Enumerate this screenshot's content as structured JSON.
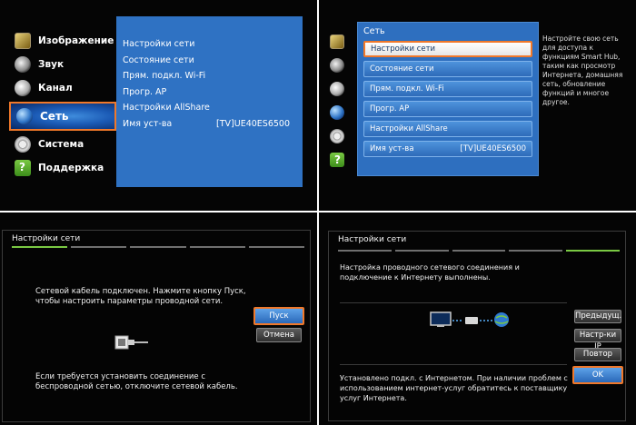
{
  "panel1": {
    "categories": [
      {
        "label": "Изображение",
        "icon": "image-icon"
      },
      {
        "label": "Звук",
        "icon": "sound-icon"
      },
      {
        "label": "Канал",
        "icon": "channel-icon"
      },
      {
        "label": "Сеть",
        "icon": "network-icon",
        "active": true
      },
      {
        "label": "Система",
        "icon": "system-icon"
      },
      {
        "label": "Поддержка",
        "icon": "support-icon"
      }
    ],
    "submenu": [
      {
        "label": "Настройки сети"
      },
      {
        "label": "Состояние сети"
      },
      {
        "label": "Прям. подкл. Wi-Fi"
      },
      {
        "label": "Прогр. AP"
      },
      {
        "label": "Настройки AllShare"
      },
      {
        "label": "Имя уст-ва",
        "value": "[TV]UE40ES6500"
      }
    ]
  },
  "panel2": {
    "title": "Сеть",
    "items": [
      {
        "label": "Настройки сети",
        "selected": true
      },
      {
        "label": "Состояние сети"
      },
      {
        "label": "Прям. подкл. Wi-Fi"
      },
      {
        "label": "Прогр. AP"
      },
      {
        "label": "Настройки AllShare"
      },
      {
        "label": "Имя уст-ва",
        "value": "[TV]UE40ES6500"
      }
    ],
    "help": "Настройте свою сеть для доступа к функциям Smart Hub, таким как просмотр Интернета, домашняя сеть, обновление функций и многое другое."
  },
  "panel3": {
    "title": "Настройки сети",
    "message_top": "Сетевой кабель подключен. Нажмите кнопку Пуск, чтобы настроить параметры проводной сети.",
    "message_bottom": "Если требуется установить соединение с беспроводной сетью, отключите сетевой кабель.",
    "buttons": {
      "start": "Пуск",
      "cancel": "Отмена"
    }
  },
  "panel4": {
    "title": "Настройки сети",
    "message_top": "Настройка проводного сетевого соединения и подключение к Интернету выполнены.",
    "message_bottom": "Установлено подкл. с Интернетом. При наличии проблем с использованием интернет-услуг обратитесь к поставщику услуг Интернета.",
    "buttons": {
      "prev": "Предыдущ.",
      "ip": "Настр-ки IP",
      "retry": "Повтор",
      "ok": "OK"
    }
  },
  "colors": {
    "highlight": "#f0782a",
    "menu_blue": "#2f72c3",
    "step_active": "#7ac943"
  }
}
